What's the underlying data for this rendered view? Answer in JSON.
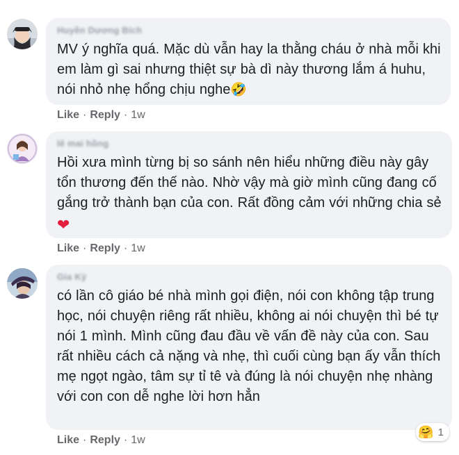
{
  "comments": [
    {
      "author": "Huyền Dương Bích",
      "text": "MV ý nghĩa quá. Mặc dù vẫn hay la thằng cháu ở nhà mỗi khi em làm gì sai nhưng thiệt sự bà dì này thương lắm á huhu, nói nhỏ nhẹ hổng chịu nghe",
      "emoji": "🤣",
      "like": "Like",
      "reply": "Reply",
      "time": "1w"
    },
    {
      "author": "lê mai hồng",
      "text": "Hồi xưa mình từng bị so sánh nên hiểu những điều này gây tổn thương đến thế nào. Nhờ vậy mà giờ mình cũng đang cố gắng trở thành bạn của con. Rất đồng cảm với những chia sẻ",
      "emoji": "❤",
      "like": "Like",
      "reply": "Reply",
      "time": "1w"
    },
    {
      "author": "Gia Kỳ",
      "text": "có lần cô giáo bé nhà mình gọi điện, nói con không tập trung học, nói chuyện riêng rất nhiều, không ai nói chuyện thì bé tự nói 1 mình. Mình cũng đau đầu về vấn đề này của con. Sau rất nhiều cách cả nặng và nhẹ, thì cuối cùng bạn ấy vẫn thích mẹ ngọt ngào, tâm sự tỉ tê và đúng là nói chuyện nhẹ nhàng với con con dễ nghe lời hơn hẳn",
      "like": "Like",
      "reply": "Reply",
      "time": "1w",
      "reaction_emoji": "🤗",
      "reaction_count": "1"
    }
  ],
  "separator": "·"
}
